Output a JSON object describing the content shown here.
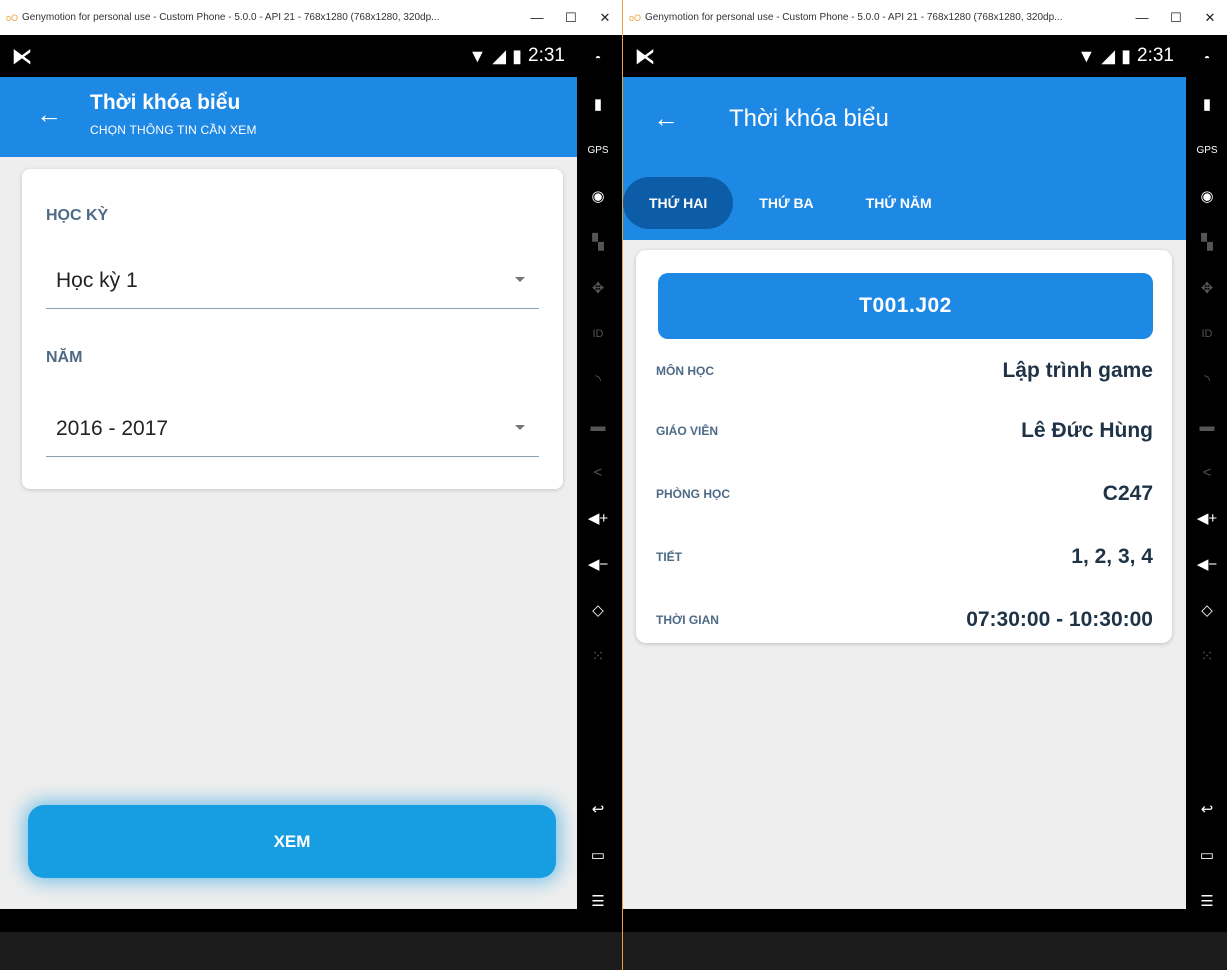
{
  "window_title": "Genymotion for personal use - Custom Phone - 5.0.0 - API 21 - 768x1280 (768x1280, 320dp...",
  "window_controls": {
    "minimize": "—",
    "maximize": "☐",
    "close": "✕"
  },
  "status": {
    "time": "2:31"
  },
  "sidebar_icons": [
    "battery-icon",
    "gps-icon",
    "camera-icon",
    "media-icon",
    "dpad-icon",
    "id-icon",
    "rss-icon",
    "sms-icon",
    "share-icon",
    "volume-up-icon",
    "volume-down-icon",
    "rotate-icon",
    "scale-icon",
    "back-icon",
    "recent-icon",
    "menu-icon",
    "home-icon"
  ],
  "screen1": {
    "title": "Thời khóa biểu",
    "subtitle": "CHỌN THÔNG TIN CẦN XEM",
    "semester_label": "HỌC KỲ",
    "semester_value": "Học kỳ 1",
    "year_label": "NĂM",
    "year_value": "2016 - 2017",
    "submit_label": "XEM"
  },
  "screen2": {
    "title": "Thời khóa biểu",
    "tabs": [
      {
        "label": "THỨ HAI",
        "active": true
      },
      {
        "label": "THỨ BA",
        "active": false
      },
      {
        "label": "THỨ NĂM",
        "active": false
      }
    ],
    "class_code": "T001.J02",
    "details": [
      {
        "key": "MÔN HỌC",
        "value": "Lập trình game"
      },
      {
        "key": "GIÁO VIÊN",
        "value": "Lê Đức Hùng"
      },
      {
        "key": "PHÒNG HỌC",
        "value": "C247"
      },
      {
        "key": "TIẾT",
        "value": "1, 2, 3, 4"
      },
      {
        "key": "THỜI GIAN",
        "value": "07:30:00 - 10:30:00"
      }
    ]
  },
  "colors": {
    "primary": "#1e88e5",
    "tab_active": "#0d5ca8",
    "button": "#179de2",
    "label": "#4d6a86",
    "value": "#1f3347"
  }
}
